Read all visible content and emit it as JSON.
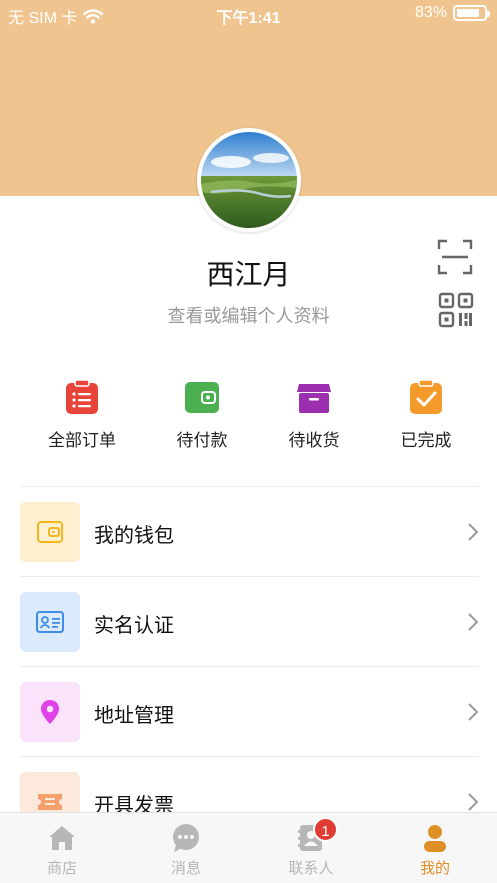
{
  "status_bar": {
    "carrier": "无 SIM 卡",
    "time": "下午1:41",
    "battery_text": "83%",
    "battery_level": 0.83
  },
  "profile": {
    "name": "西江月",
    "subtitle": "查看或编辑个人资料"
  },
  "orders": [
    {
      "label": "全部订单",
      "icon": "order-list-icon",
      "color": "#e8443a"
    },
    {
      "label": "待付款",
      "icon": "wallet-icon",
      "color": "#4caf50"
    },
    {
      "label": "待收货",
      "icon": "box-icon",
      "color": "#9c2fb0"
    },
    {
      "label": "已完成",
      "icon": "clipboard-check-icon",
      "color": "#f39a2a"
    }
  ],
  "menu": [
    {
      "label": "我的钱包",
      "icon": "wallet-icon",
      "bg": "#fdefcf",
      "fg": "#f2b51d"
    },
    {
      "label": "实名认证",
      "icon": "id-card-icon",
      "bg": "#dbeafc",
      "fg": "#3f8de8"
    },
    {
      "label": "地址管理",
      "icon": "location-pin-icon",
      "bg": "#fbe3fb",
      "fg": "#e040e8"
    },
    {
      "label": "开具发票",
      "icon": "ticket-icon",
      "bg": "#fde8dc",
      "fg": "#f5a06a"
    }
  ],
  "tabs": [
    {
      "label": "商店",
      "icon": "home-icon",
      "active": false
    },
    {
      "label": "消息",
      "icon": "chat-bubble-icon",
      "active": false
    },
    {
      "label": "联系人",
      "icon": "contacts-icon",
      "active": false,
      "badge": "1"
    },
    {
      "label": "我的",
      "icon": "person-icon",
      "active": true
    }
  ],
  "colors": {
    "header_bg": "#f0c48e",
    "accent": "#e08f27",
    "tab_inactive": "#b7b7b7",
    "badge": "#e13b34"
  }
}
